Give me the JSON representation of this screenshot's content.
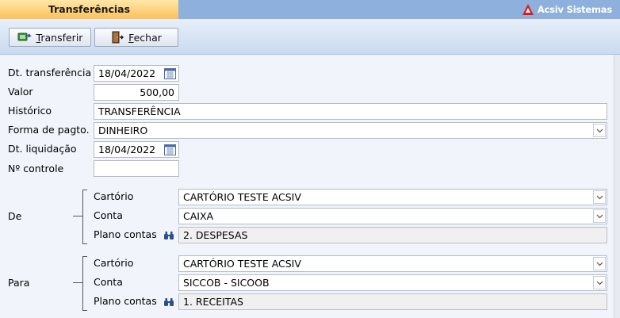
{
  "header": {
    "tab_title": "Transferências",
    "brand": "Acsiv Sistemas"
  },
  "toolbar": {
    "transferir_rest": "ransferir",
    "transferir_hotkey": "T",
    "fechar_rest": "echar",
    "fechar_hotkey": "F"
  },
  "form": {
    "dt_transferencia_label": "Dt. transferência",
    "dt_transferencia_value": "18/04/2022",
    "valor_label": "Valor",
    "valor_value": "500,00",
    "historico_label": "Histórico",
    "historico_value": "TRANSFERÊNCIA",
    "forma_pagto_label": "Forma de pagto.",
    "forma_pagto_value": "DINHEIRO",
    "dt_liquidacao_label": "Dt. liquidação",
    "dt_liquidacao_value": "18/04/2022",
    "n_controle_label": "Nº controle",
    "n_controle_value": ""
  },
  "de": {
    "group_label": "De",
    "cartorio_label": "Cartório",
    "cartorio_value": "CARTÓRIO TESTE ACSIV",
    "conta_label": "Conta",
    "conta_value": "CAIXA",
    "plano_label": "Plano contas",
    "plano_value": "2. DESPESAS"
  },
  "para": {
    "group_label": "Para",
    "cartorio_label": "Cartório",
    "cartorio_value": "CARTÓRIO TESTE ACSIV",
    "conta_label": "Conta",
    "conta_value": "SICCOB - SICOOB",
    "plano_label": "Plano contas",
    "plano_value": "1. RECEITAS"
  },
  "icons": {
    "calendar": "calendar-icon",
    "dropdown": "chevron-down-icon",
    "search": "binoculars-icon",
    "transfer": "transfer-icon",
    "exit": "exit-door-icon"
  },
  "colors": {
    "tab_active": "#fbc15c",
    "header_bar": "#8eb0dc",
    "brand_logo": "#e01b1b",
    "form_bg": "#f1f5fb"
  }
}
